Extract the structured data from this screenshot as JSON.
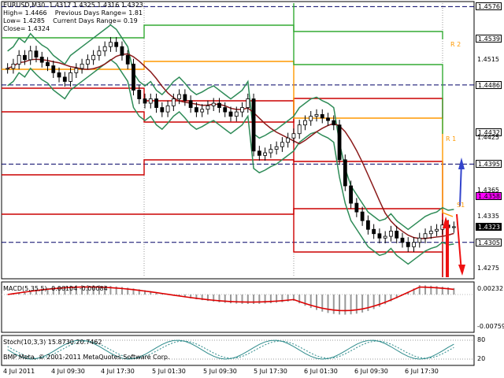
{
  "header": {
    "line1": "EURUSD,M30  1.4317 1.4325 1.4316 1.4323",
    "line2": "High= 1.4466    Previous Days Range= 1.81",
    "line3": "Low= 1.4285    Current Days Range= 0.19",
    "line4": "Close= 1.4324"
  },
  "price_axis": {
    "ticks": [
      "1.4576",
      "1.4539",
      "1.4515",
      "1.4486",
      "1.4432",
      "1.4425",
      "1.4395",
      "1.4365",
      "1.4358",
      "1.4335",
      "1.4323",
      "1.4305",
      "1.4275"
    ],
    "tags": [
      {
        "text": "1.4576",
        "color": "#000000",
        "bg": "#ffffff"
      },
      {
        "text": "1.4539",
        "color": "#000000",
        "bg": "#ffffff"
      },
      {
        "text": "1.4486",
        "color": "#000000",
        "bg": "#ffffff"
      },
      {
        "text": "1.4432",
        "color": "#000000",
        "bg": "#ffffff"
      },
      {
        "text": "1.4395",
        "color": "#000000",
        "bg": "#ffffff"
      },
      {
        "text": "1.4358",
        "color": "#000000",
        "bg": "#ff00ff"
      },
      {
        "text": "1.4323",
        "color": "#ffffff",
        "bg": "#000000"
      },
      {
        "text": "1.4305",
        "color": "#000000",
        "bg": "#ffffff"
      }
    ],
    "plain": [
      "1.4515",
      "1.4425",
      "1.4365",
      "1.4335",
      "1.4275"
    ]
  },
  "level_labels": [
    "R 2",
    "R 1",
    "S1"
  ],
  "macd": {
    "label": "MACD(5,35,5) -0.00104 -0.00084",
    "axis_top": "0.00232",
    "axis_bottom": "-0.00759"
  },
  "stoch": {
    "label": "Stoch(10,3,3) 15.8730 20.7462",
    "axis_top": "80",
    "axis_bottom": "20"
  },
  "copyright": "BMP Meta, © 2001-2011 MetaQuotes Software Corp.",
  "time_axis": [
    "4 Jul 2011",
    "4 Jul 09:30",
    "4 Jul 17:30",
    "5 Jul 01:30",
    "5 Jul 09:30",
    "5 Jul 17:30",
    "6 Jul 01:30",
    "6 Jul 09:30",
    "6 Jul 17:30"
  ],
  "colors": {
    "bull": "#000000",
    "bear": "#000000",
    "bollinger": "#2e8b57",
    "ma": "#8b1a1a",
    "pivot_red": "#cc0000",
    "pivot_green": "#33aa33",
    "pivot_orange": "#ff9900",
    "arrow_up": "#3344cc",
    "arrow_down": "#ee1111"
  },
  "chart_data": {
    "type": "candlestick",
    "symbol": "EURUSD",
    "timeframe": "M30",
    "ylim": [
      1.4265,
      1.458
    ],
    "closes": [
      1.4505,
      1.451,
      1.452,
      1.4515,
      1.4525,
      1.4518,
      1.4512,
      1.4508,
      1.45,
      1.4495,
      1.449,
      1.45,
      1.4505,
      1.451,
      1.4515,
      1.452,
      1.4525,
      1.453,
      1.4535,
      1.453,
      1.452,
      1.451,
      1.448,
      1.447,
      1.4465,
      1.447,
      1.446,
      1.4455,
      1.4462,
      1.447,
      1.4475,
      1.4468,
      1.446,
      1.4455,
      1.4458,
      1.4462,
      1.4465,
      1.446,
      1.4455,
      1.445,
      1.4455,
      1.446,
      1.447,
      1.441,
      1.4405,
      1.4408,
      1.4412,
      1.4415,
      1.442,
      1.4425,
      1.443,
      1.444,
      1.4445,
      1.445,
      1.4452,
      1.4448,
      1.4445,
      1.444,
      1.44,
      1.437,
      1.435,
      1.434,
      1.433,
      1.432,
      1.4315,
      1.431,
      1.4312,
      1.4318,
      1.431,
      1.4305,
      1.43,
      1.4305,
      1.431,
      1.4315,
      1.4318,
      1.432,
      1.4325,
      1.4322,
      1.4323
    ]
  }
}
